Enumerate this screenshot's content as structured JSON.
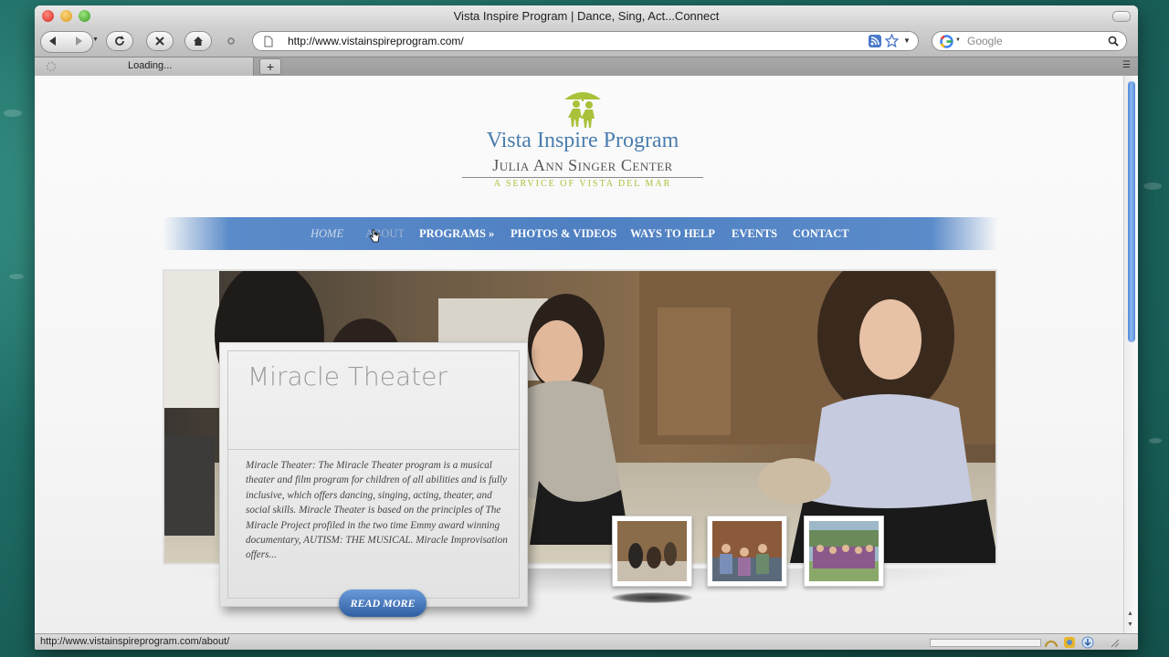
{
  "browser": {
    "window_title": "Vista Inspire Program | Dance, Sing, Act...Connect",
    "url": "http://www.vistainspireprogram.com/",
    "search_placeholder": "Google",
    "tab_label": "Loading...",
    "new_tab": "+",
    "status_url": "http://www.vistainspireprogram.com/about/"
  },
  "logo": {
    "line1": "Vista Inspire Program",
    "line2": "Julia Ann Singer Center",
    "line3": "A SERVICE OF VISTA DEL MAR"
  },
  "nav": {
    "items": [
      {
        "label": "HOME"
      },
      {
        "label": "ABOUT"
      },
      {
        "label": "PROGRAMS »"
      },
      {
        "label": "PHOTOS & VIDEOS"
      },
      {
        "label": "WAYS TO HELP"
      },
      {
        "label": "EVENTS"
      },
      {
        "label": "CONTACT"
      }
    ]
  },
  "feature": {
    "title": "Miracle Theater",
    "body": "Miracle Theater: The Miracle Theater program is a musical theater and film program for children of all abilities and is fully inclusive, which offers dancing, singing, acting, theater, and social skills.  Miracle Theater is based on the principles of The Miracle Project profiled in the two time Emmy award winning documentary, AUTISM: THE MUSICAL.  Miracle Improvisation offers...",
    "button": "READ MORE"
  },
  "colors": {
    "nav_blue": "#4f80c2",
    "logo_blue": "#4a7dae",
    "logo_green": "#a8c23a",
    "button_blue": "#2f5ea3"
  }
}
